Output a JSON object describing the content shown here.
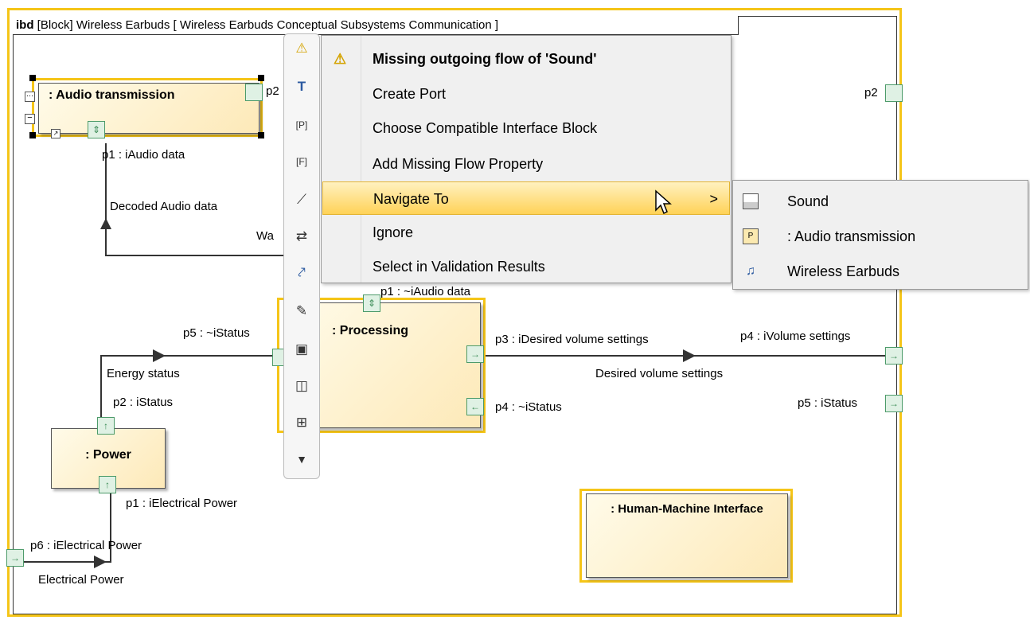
{
  "diagram": {
    "frame_kind": "ibd",
    "frame_title": "[Block] Wireless Earbuds [ Wireless Earbuds Conceptual Subsystems Communication ]",
    "blocks": {
      "audio": ": Audio transmission",
      "processing": ": Processing",
      "power": ": Power",
      "hmi": ": Human-Machine Interface"
    },
    "labels": {
      "audio_p1": "p1 : iAudio data",
      "audio_p2_partial": "p2",
      "decoded": "Decoded Audio data",
      "wa": "Wa",
      "proc_p1": "p1 : ~iAudio data",
      "proc_p5": "p5 : ~iStatus",
      "proc_p3": "p3 : iDesired volume settings",
      "proc_p4": "p4 : ~iStatus",
      "energy": "Energy status",
      "power_p2": "p2 : iStatus",
      "power_p1": "p1 : iElectrical Power",
      "p6": "p6 : iElectrical Power",
      "electrical": "Electrical Power",
      "desired": "Desired volume settings",
      "right_p2": "p2",
      "right_p4": "p4 : iVolume settings",
      "right_p5": "p5 : iStatus"
    }
  },
  "context_menu": {
    "header": "Missing outgoing flow of 'Sound'",
    "items": [
      "Create Port",
      "Choose Compatible Interface Block",
      "Add Missing Flow Property",
      "Navigate To",
      "Ignore",
      "Select in Validation Results"
    ],
    "highlighted": "Navigate To",
    "submenu_arrow": ">"
  },
  "submenu": {
    "items": [
      "Sound",
      ": Audio transmission",
      "Wireless Earbuds"
    ]
  },
  "toolbar": {
    "icons": [
      "warning-icon",
      "text-icon",
      "port-p-icon",
      "port-f-icon",
      "connector-icon",
      "flow-connector-icon",
      "dependency-icon",
      "note-icon",
      "image-icon",
      "frame-icon",
      "structure-icon",
      "more-icon"
    ]
  },
  "colors": {
    "selection": "#f5c518",
    "block_fill_top": "#fffbe9",
    "block_fill_bottom": "#fde9b8",
    "port_border": "#4d9b6a",
    "menu_highlight": "#ffd257"
  }
}
